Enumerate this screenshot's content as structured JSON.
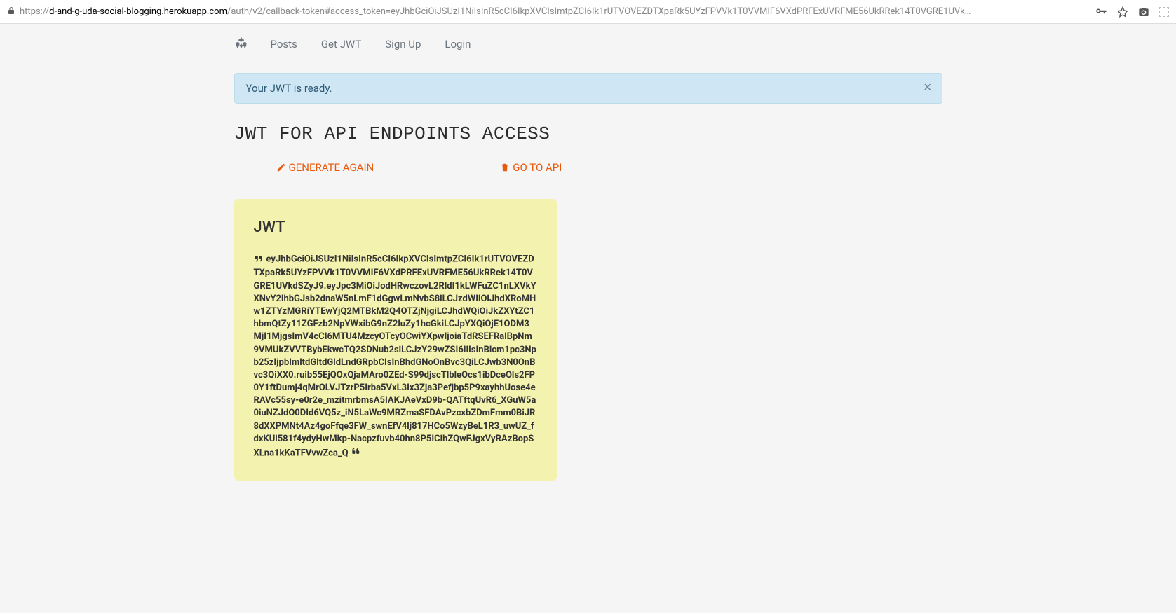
{
  "browser": {
    "url_domain": "d-and-g-uda-social-blogging.herokuapp.com",
    "url_path": "/auth/v2/callback-token#access_token=eyJhbGciOiJSUzI1NiIsInR5cCI6IkpXVCIsImtpZCI6Ik1rUTVOVEZDTXpaRk5UYzFPVVk1T0VVMIF6VXdPRFExUVRFME56UkRRek14T0VGRE1UVk…"
  },
  "nav": {
    "posts": "Posts",
    "get_jwt": "Get JWT",
    "sign_up": "Sign Up",
    "login": "Login"
  },
  "alert": {
    "message": "Your JWT is ready.",
    "close": "×"
  },
  "page": {
    "title": "JWT FOR API ENDPOINTS ACCESS"
  },
  "actions": {
    "generate": "GENERATE AGAIN",
    "go_api": "GO TO API"
  },
  "jwt": {
    "label": "JWT",
    "token": "eyJhbGciOiJSUzI1NiIsInR5cCI6IkpXVCIsImtpZCI6Ik1rUTVOVEZDTXpaRk5UYzFPVVk1T0VVMIF6VXdPRFExUVRFME56UkRRek14T0VGRE1UVkdSZyJ9.eyJpc3MiOiJodHRwczovL2RldI1kLWFuZC1nLXVkYXNvY2lhbGJsb2dnaW5nLmF1dGgwLmNvbS8iLCJzdWIiOiJhdXRoMHw1ZTYzMGRiYTEwYjQ2MTBkM2Q4OTZjNjgiLCJhdWQiOiJkZXYtZC1hbmQtZy11ZGFzb2NpYWxibG9nZ2luZy1hcGkiLCJpYXQiOjE1ODM3MjI1MjgsImV4cCI6MTU4MzcyOTcyOCwiYXpwIjoiaTdRSEFRalBpNm9VMUkZVVTBybEkwcTQ2SDNub2siLCJzY29wZSI6IiIsInBlcm1pc3Npb25zIjpbImltdGltdGldLndGRpbCIsInBhdGNoOnBvc3QiLCJwb3N0OnBvc3QiXX0.ruib55EjQOxQjaMAro0ZEd-S99djscTlbleOcs1ibDceOls2FP0Y1ftDumj4qMrOLVJTzrP5Irba5VxL3Ix3Zja3Pefjbp5P9xayhhUose4eRAVc55sy-e0r2e_mzitmrbmsA5IAKJAeVxD9b-QATftqUvR6_XGuW5a0iuNZJdO0DId6VQ5z_iN5LaWc9MRZmaSFDAvPzcxbZDmFmm0BiJR8dXXPMNt4Az4goFfqe3FW_swnEfV4lj817HCo5WzyBeL1R3_uwUZ_fdxKUi581f4ydyHwMkp-Nacpzfuvb40hn8P5ICihZQwFJgxVyRAzBopSXLna1kKaTFVvwZca_Q"
  }
}
